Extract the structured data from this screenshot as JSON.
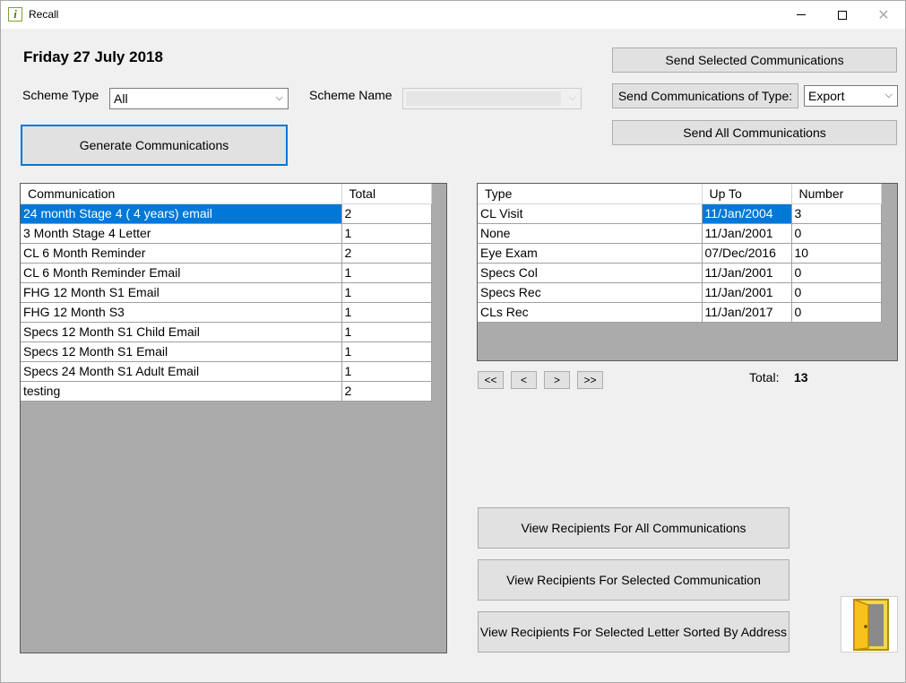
{
  "window": {
    "title": "Recall",
    "app_icon_glyph": "i",
    "close_glyph": "✕"
  },
  "date_label": "Friday 27 July 2018",
  "scheme_type": {
    "label": "Scheme Type",
    "value": "All"
  },
  "scheme_name": {
    "label": "Scheme Name",
    "value": ""
  },
  "buttons": {
    "generate": "Generate Communications",
    "send_selected": "Send Selected Communications",
    "send_of_type": "Send Communications of Type:",
    "send_all": "Send All Communications",
    "view_all": "View Recipients For All Communications",
    "view_selected": "View Recipients For Selected Communication",
    "view_sorted": "View Recipients For Selected Letter Sorted By Address"
  },
  "send_type_select": {
    "value": "Export"
  },
  "communications_table": {
    "headers": [
      "Communication",
      "Total"
    ],
    "rows": [
      {
        "name": "24 month Stage 4 ( 4 years) email",
        "total": "2",
        "selected": true
      },
      {
        "name": "3 Month Stage 4 Letter",
        "total": "1"
      },
      {
        "name": "CL 6 Month Reminder",
        "total": "2"
      },
      {
        "name": "CL 6 Month Reminder Email",
        "total": "1"
      },
      {
        "name": "FHG 12 Month S1 Email",
        "total": "1"
      },
      {
        "name": "FHG 12 Month S3",
        "total": "1"
      },
      {
        "name": "Specs 12 Month S1 Child Email",
        "total": "1"
      },
      {
        "name": "Specs 12 Month S1 Email",
        "total": "1"
      },
      {
        "name": "Specs 24 Month S1 Adult Email",
        "total": "1"
      },
      {
        "name": "testing",
        "total": "2"
      }
    ]
  },
  "types_table": {
    "headers": [
      "Type",
      "Up To",
      "Number"
    ],
    "rows": [
      {
        "type": "CL Visit",
        "up_to": "11/Jan/2004",
        "number": "3",
        "selected_cell": true
      },
      {
        "type": "None",
        "up_to": "11/Jan/2001",
        "number": "0"
      },
      {
        "type": "Eye Exam",
        "up_to": "07/Dec/2016",
        "number": "10"
      },
      {
        "type": "Specs Col",
        "up_to": "11/Jan/2001",
        "number": "0"
      },
      {
        "type": "Specs Rec",
        "up_to": "11/Jan/2001",
        "number": "0"
      },
      {
        "type": "CLs Rec",
        "up_to": "11/Jan/2017",
        "number": "0"
      }
    ]
  },
  "pager": {
    "first": "<<",
    "prev": "<",
    "next": ">",
    "last": ">>"
  },
  "total": {
    "label": "Total:",
    "value": "13"
  },
  "colors": {
    "selection": "#0078d7",
    "grid_bg": "#ababab",
    "focus_border": "#0078d7"
  },
  "icons": {
    "exit": "open-door-icon",
    "dropdown": "chevron-down-icon"
  }
}
